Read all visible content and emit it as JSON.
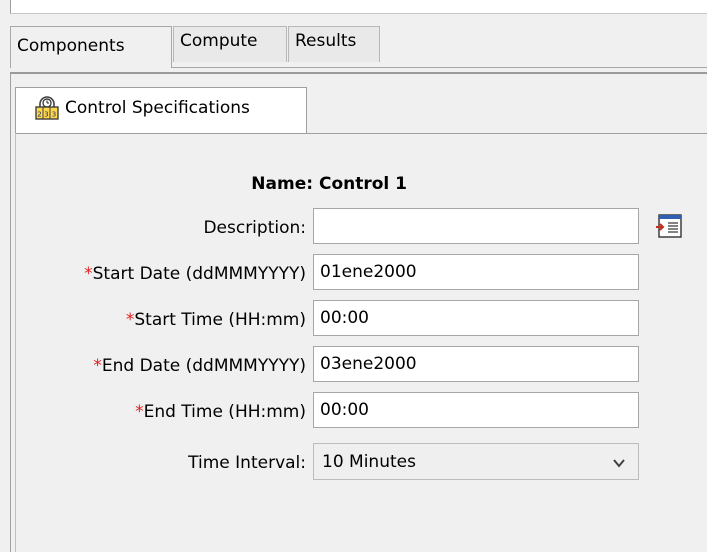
{
  "tabs": {
    "components": "Components",
    "compute": "Compute",
    "results": "Results"
  },
  "subtab": {
    "label": "Control Specifications",
    "icon": "control-specs-icon"
  },
  "form": {
    "name_label": "Name:",
    "name_value": "Control 1",
    "description_label": "Description:",
    "description_value": "",
    "start_date_label": "Start Date (ddMMMYYYY)",
    "start_date_value": "01ene2000",
    "start_time_label": "Start Time (HH:mm)",
    "start_time_value": "00:00",
    "end_date_label": "End Date (ddMMMYYYY)",
    "end_date_value": "03ene2000",
    "end_time_label": "End Time (HH:mm)",
    "end_time_value": "00:00",
    "time_interval_label": "Time Interval:",
    "time_interval_value": "10 Minutes",
    "required_marker": "*"
  },
  "colors": {
    "required": "#e02020",
    "background": "#f0f0f0"
  }
}
